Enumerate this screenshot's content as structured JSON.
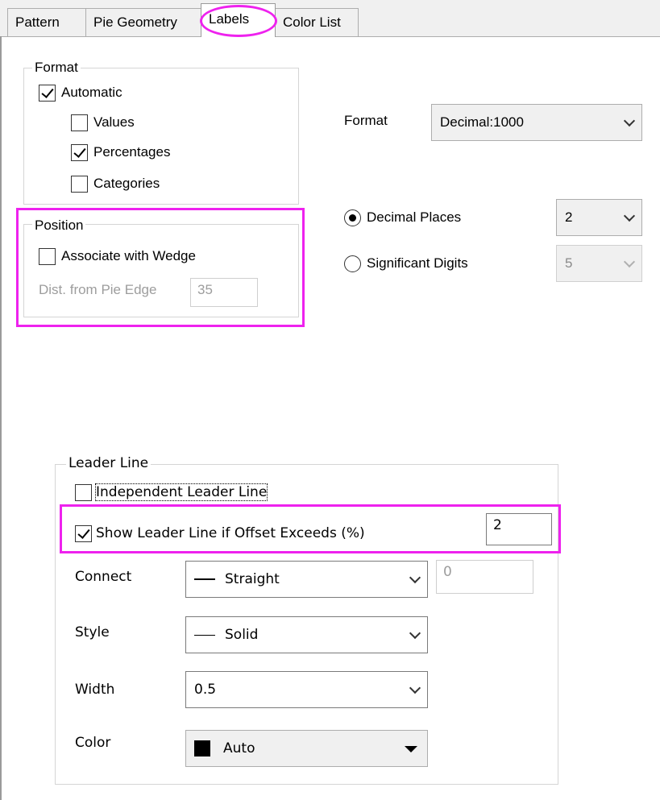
{
  "tabs": [
    {
      "label": "Pattern",
      "active": false
    },
    {
      "label": "Pie Geometry",
      "active": false
    },
    {
      "label": "Labels",
      "active": true
    },
    {
      "label": "Color List",
      "active": false
    }
  ],
  "format_group": {
    "title": "Format",
    "automatic": {
      "label": "Automatic",
      "checked": true
    },
    "values": {
      "label": "Values",
      "checked": false
    },
    "percentages": {
      "label": "Percentages",
      "checked": true
    },
    "categories": {
      "label": "Categories",
      "checked": false
    }
  },
  "format_select": {
    "label": "Format",
    "value": "Decimal:1000"
  },
  "position_group": {
    "title": "Position",
    "associate": {
      "label": "Associate with Wedge",
      "checked": false
    },
    "dist_label": "Dist. from Pie Edge",
    "dist_value": "35"
  },
  "decimal_places": {
    "label": "Decimal Places",
    "selected": true,
    "value": "2"
  },
  "significant_digits": {
    "label": "Significant Digits",
    "selected": false,
    "value": "5"
  },
  "leader_line": {
    "title": "Leader Line",
    "independent": {
      "label": "Independent Leader Line",
      "checked": false
    },
    "show_if_offset": {
      "label": "Show Leader Line if Offset Exceeds (%)",
      "checked": true,
      "value": "2"
    },
    "connect": {
      "label": "Connect",
      "value": "Straight",
      "offset_value": "0"
    },
    "style": {
      "label": "Style",
      "value": "Solid"
    },
    "width": {
      "label": "Width",
      "value": "0.5"
    },
    "color": {
      "label": "Color",
      "value": "Auto",
      "swatch": "#000000"
    }
  },
  "highlight_color": "#ee22ee"
}
